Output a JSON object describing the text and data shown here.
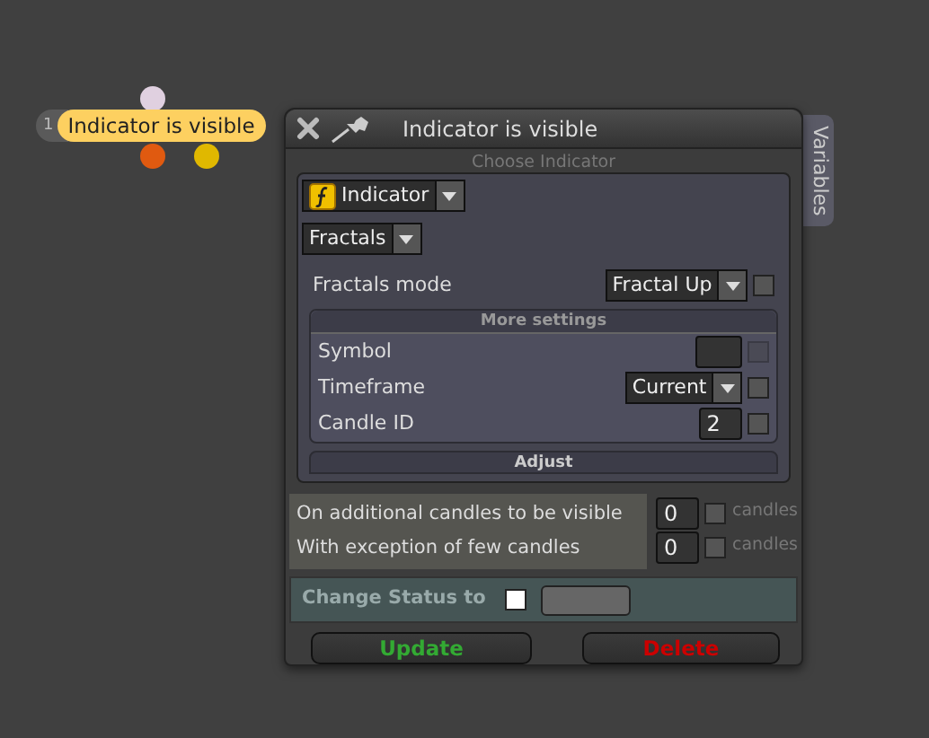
{
  "node": {
    "number": "1",
    "label": "Indicator is visible"
  },
  "window": {
    "title": "Indicator is visible",
    "side_tab": "Variables"
  },
  "choose_indicator": {
    "heading": "Choose Indicator",
    "type": "Indicator",
    "indicator": "Fractals"
  },
  "mode": {
    "label": "Fractals mode",
    "value": "Fractal Up",
    "checked": false
  },
  "more_settings": {
    "heading": "More settings",
    "rows": [
      {
        "kind": "field",
        "label": "Symbol",
        "checked": false,
        "disabled": true
      },
      {
        "kind": "select",
        "label": "Timeframe",
        "value": "Current",
        "checked": false,
        "disabled": false
      },
      {
        "kind": "field",
        "label": "Candle ID",
        "value": "2",
        "checked": false,
        "disabled": false
      }
    ]
  },
  "adjust": {
    "heading": "Adjust"
  },
  "candles": [
    {
      "label": "On additional candles to be visible",
      "value": "0",
      "checked": false,
      "unit": "candles"
    },
    {
      "label": "With exception of few candles",
      "value": "0",
      "checked": false,
      "unit": "candles"
    }
  ],
  "status": {
    "label": "Change Status to",
    "checked": false
  },
  "buttons": [
    {
      "label": "Update",
      "kind": "update"
    },
    {
      "label": "Delete",
      "kind": "delete"
    }
  ]
}
